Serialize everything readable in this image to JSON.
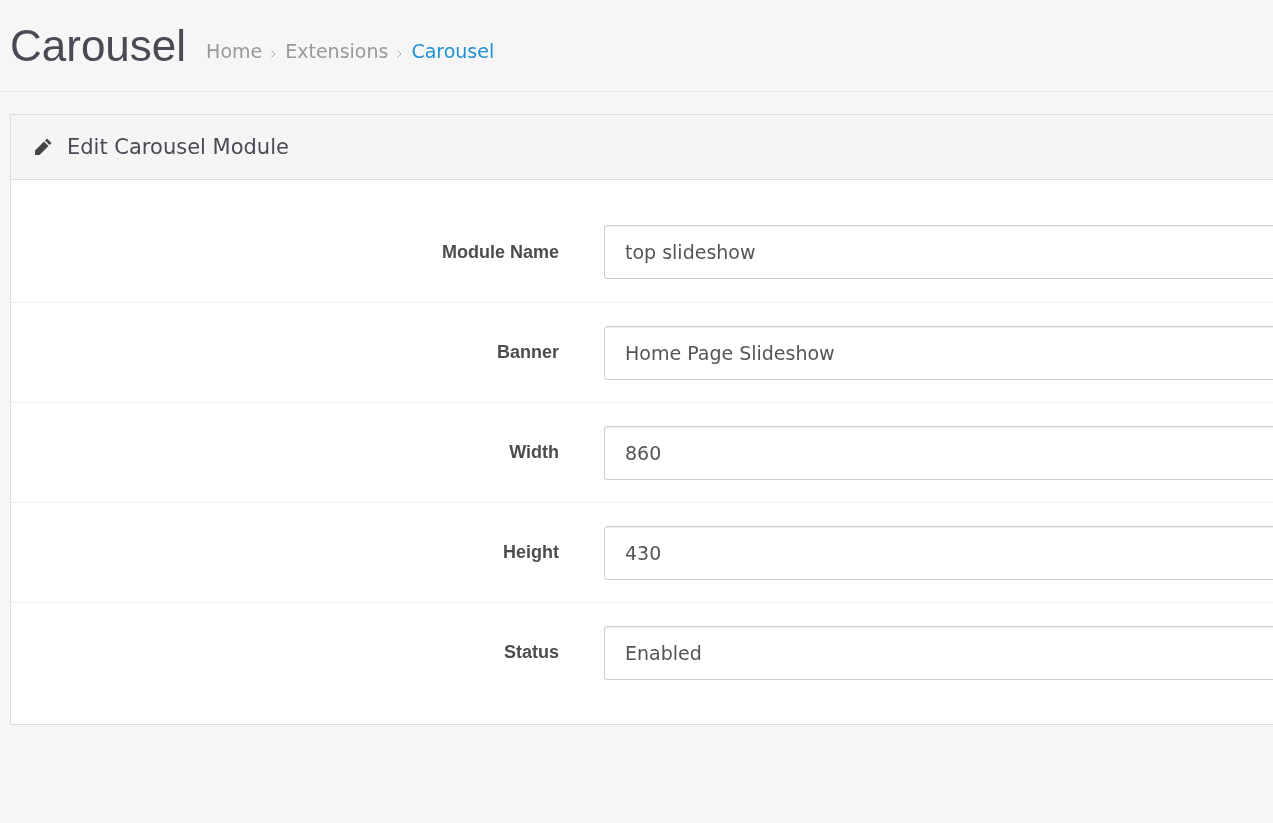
{
  "page_title": "Carousel",
  "breadcrumb": [
    {
      "label": "Home",
      "selected": false
    },
    {
      "label": "Extensions",
      "selected": false
    },
    {
      "label": "Carousel",
      "selected": true
    }
  ],
  "panel": {
    "title": "Edit Carousel Module",
    "fields": [
      {
        "label": "Module Name",
        "value": "top slideshow"
      },
      {
        "label": "Banner",
        "value": "Home Page Slideshow"
      },
      {
        "label": "Width",
        "value": "860"
      },
      {
        "label": "Height",
        "value": "430"
      },
      {
        "label": "Status",
        "value": "Enabled"
      }
    ]
  }
}
